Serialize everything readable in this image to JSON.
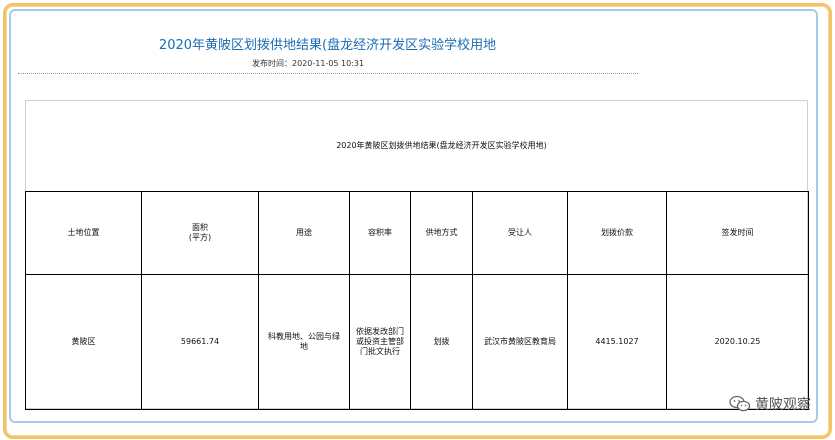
{
  "document": {
    "title": "2020年黄陂区划拨供地结果(盘龙经济开发区实验学校用地",
    "publish_label": "发布时间：",
    "publish_time": "2020-11-05 10:31"
  },
  "table": {
    "caption": "2020年黄陂区划拨供地结果(盘龙经济开发区实验学校用地)",
    "headers": [
      "土地位置",
      "面积\n(平方)",
      "用途",
      "容积率",
      "供地方式",
      "受让人",
      "划拨价款",
      "签发时间"
    ],
    "rows": [
      [
        "黄陂区",
        "59661.74",
        "科教用地、公园与绿地",
        "依据发改部门或投资主管部门批文执行",
        "划拨",
        "武汉市黄陂区教育局",
        "4415.1027",
        "2020.10.25"
      ]
    ]
  },
  "watermark": {
    "text": "黄陂观察",
    "icon": "wechat-icon"
  },
  "colors": {
    "title": "#1b6bb5",
    "frame": "#f2c36b",
    "inner_border": "#a9c9e8"
  }
}
